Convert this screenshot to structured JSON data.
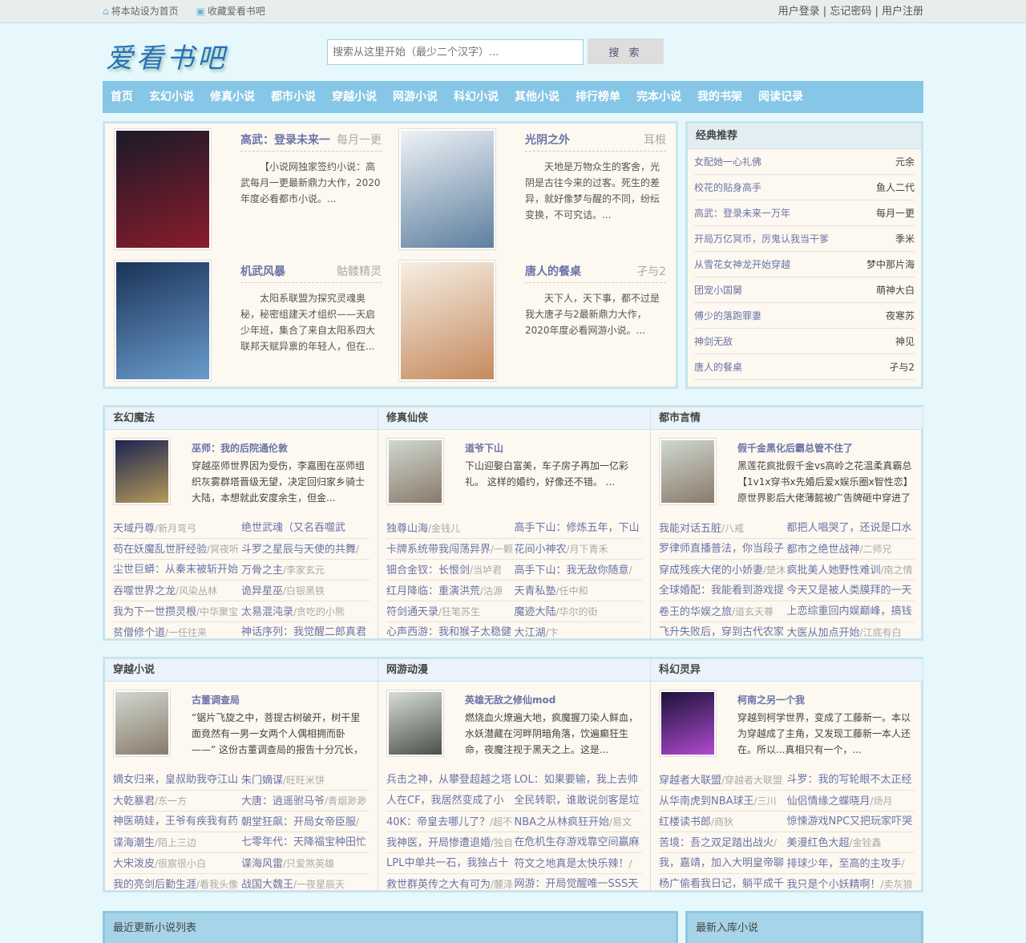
{
  "topbar": {
    "home": "将本站设为首页",
    "fav": "收藏爱看书吧",
    "login": "用户登录",
    "forgot": "忘记密码",
    "register": "用户注册"
  },
  "logo": "爱看书吧",
  "search": {
    "placeholder": "搜索从这里开始（最少二个汉字）...",
    "button": "搜 索"
  },
  "nav": [
    "首页",
    "玄幻小说",
    "修真小说",
    "都市小说",
    "穿越小说",
    "网游小说",
    "科幻小说",
    "其他小说",
    "排行榜单",
    "完本小说",
    "我的书架",
    "阅读记录"
  ],
  "featured": [
    {
      "title": "高武：登录未来一",
      "author": "每月一更",
      "desc": "【小说网独家签约小说：高武每月一更最新鼎力大作，2020年度必看都市小说。...",
      "colors": [
        "#1a1a2a",
        "#8a1c2a"
      ]
    },
    {
      "title": "光阴之外",
      "author": "耳根",
      "desc": "天地是万物众生的客舍，光阴是古往今来的过客。死生的差异，就好像梦与醒的不同，纷纭变换，不可究诘。...",
      "colors": [
        "#eef2f6",
        "#5d7f9e"
      ]
    },
    {
      "title": "机武风暴",
      "author": "骷髅精灵",
      "desc": "太阳系联盟为探究灵魂奥秘，秘密组建天才组织——天启少年班，集合了来自太阳系四大联邦天赋异禀的年轻人，但在...",
      "colors": [
        "#1b3358",
        "#6a9ccc"
      ]
    },
    {
      "title": "唐人的餐桌",
      "author": "孑与2",
      "desc": "天下人，天下事，都不过是我大唐孑与2最新鼎力大作，2020年度必看网游小说。...",
      "colors": [
        "#f6efe4",
        "#c58a5e"
      ]
    }
  ],
  "recommend": {
    "title": "经典推荐",
    "items": [
      [
        "女配她一心礼佛",
        "元余"
      ],
      [
        "校花的贴身高手",
        "鱼人二代"
      ],
      [
        "高武：登录未来一万年",
        "每月一更"
      ],
      [
        "开局万亿冥币，厉鬼认我当干爹",
        "季米"
      ],
      [
        "从雪花女神龙开始穿越",
        "梦中那片海"
      ],
      [
        "团宠小国舅",
        "萌神大白"
      ],
      [
        "傅少的落跑罪妻",
        "夜寒苏"
      ],
      [
        "神剑无敌",
        "神见"
      ],
      [
        "唐人的餐桌",
        "孑与2"
      ]
    ]
  },
  "sections": [
    {
      "name": "玄幻魔法",
      "title": "巫师：我的后院通伦敦",
      "desc": "穿越巫师世界因为受伤，李嘉图在巫师组织灰雾群塔晋级无望，决定回归家乡骑士大陆，本想就此安度余生，但金...",
      "colors": [
        "#1c2450",
        "#b59a5a"
      ],
      "list": [
        [
          "天域丹尊",
          "新月弯弓"
        ],
        [
          "绝世武魂（又名吞噬武",
          null
        ],
        [
          "苟在妖魔乱世肝经验",
          "冥夜听"
        ],
        [
          "斗罗之星辰与天使的共舞",
          ""
        ],
        [
          "尘世巨蟒：从秦末被斩开始",
          null
        ],
        [
          "万骨之主",
          "李家玄元"
        ],
        [
          "吞噬世界之龙",
          "风染丛林"
        ],
        [
          "诡异星巫",
          "白银黑铁"
        ],
        [
          "我为下一世攒灵根",
          "中华聚宝"
        ],
        [
          "太易混沌录",
          "贪吃的小熊"
        ],
        [
          "贫僧修个道",
          "一任往来"
        ],
        [
          "神话序列：我觉醒二郎真君",
          null
        ]
      ]
    },
    {
      "name": "修真仙侠",
      "title": "道爷下山",
      "desc": "下山迎娶白富美，车子房子再加一亿彩礼。 这样的婚约，好像还不错。 ...",
      "colors": [
        "#cfd8d0",
        "#8a7a6a"
      ],
      "list": [
        [
          "独尊山海",
          "金钱儿"
        ],
        [
          "高手下山：修炼五年，下山",
          null
        ],
        [
          "卡牌系统带我闯荡异界",
          "一颗"
        ],
        [
          "花间小神农",
          "月下青禾"
        ],
        [
          "钿合金钗：长恨剑",
          "当垆君"
        ],
        [
          "高手下山：我无敌你随意",
          ""
        ],
        [
          "红月降临：重演洪荒",
          "沽源"
        ],
        [
          "天青私塾",
          "任中和"
        ],
        [
          "符剑通天录",
          "狂笔苏生"
        ],
        [
          "魔迹大陆",
          "华尔的街"
        ],
        [
          "心声西游：我和猴子太稳健",
          null
        ],
        [
          "大江湖",
          "卞"
        ]
      ]
    },
    {
      "name": "都市言情",
      "title": "假千金黑化后霸总管不住了",
      "desc": "黑莲花疯批假千金vs高岭之花温柔真霸总【1v1x穿书x先婚后爱x娱乐圈x智性恋】原世界影后大佬薄懿被广告牌砸中穿进了",
      "colors": [
        "#cfd8d0",
        "#8a7a6a"
      ],
      "list": [
        [
          "我能对话五脏",
          "八戒"
        ],
        [
          "都把人唱哭了，还说是口水",
          null
        ],
        [
          "罗律师直播普法，你当段子",
          null
        ],
        [
          "都市之绝世战神",
          "二师兄"
        ],
        [
          "穿成残疾大佬的小娇妻",
          "楚沐"
        ],
        [
          "疯批美人她野性难训",
          "南之情"
        ],
        [
          "全球婚配：我能看到游戏提",
          null
        ],
        [
          "今天又是被人类膜拜的一天",
          null
        ],
        [
          "卷王的华娱之旅",
          "道玄天尊"
        ],
        [
          "上恋综重回内娱巅峰，搞钱",
          null
        ],
        [
          "飞升失败后，穿到古代农家",
          null
        ],
        [
          "大医从加点开始",
          "江底有白"
        ]
      ]
    },
    {
      "name": "穿越小说",
      "title": "古董调查局",
      "desc": "“锯片飞旋之中，菩提古树破开，树干里面竟然有一男一女两个人偶相拥而卧——” 这份古董调查局的报告十分冗长，其中",
      "colors": [
        "#cfd8d0",
        "#8a7a6a"
      ],
      "list": [
        [
          "嫡女归来，皇叔助我夺江山",
          null
        ],
        [
          "朱门嫡谋",
          "旺旺米饼"
        ],
        [
          "大乾暴君",
          "东一方"
        ],
        [
          "大唐：逍遥驸马爷",
          "青烟渺渺"
        ],
        [
          "神医萌娃，王爷有疾我有药",
          null
        ],
        [
          "朝堂狂飙：开局女帝臣服",
          ""
        ],
        [
          "谍海潮生",
          "陌上三边"
        ],
        [
          "七零年代：天降福宝种田忙",
          null
        ],
        [
          "大宋泼皮",
          "很宸很小白"
        ],
        [
          "谍海风雷",
          "只爱煞英雄"
        ],
        [
          "我的亮剑后勤生涯",
          "看我头像"
        ],
        [
          "战国大魏王",
          "一夜星辰天"
        ]
      ]
    },
    {
      "name": "网游动漫",
      "title": "英雄无敌之修仙mod",
      "desc": "燃烧血火燎遍大地，疯魔握刀染人鲜血，水妖潜藏在河畔阴暗角落，饮遍癫狂生命，夜魔注视于黑天之上。这是...",
      "colors": [
        "#d8dcd8",
        "#4a5048"
      ],
      "list": [
        [
          "兵击之神，从攀登超越之塔",
          null
        ],
        [
          "LOL：如果要输，我上去帅",
          null
        ],
        [
          "人在CF，我居然变成了小",
          null
        ],
        [
          "全民转职，谁敢说剑客是垃",
          null
        ],
        [
          "40K：帝皇去哪儿了？",
          "超不"
        ],
        [
          "NBA之从林疯狂开始",
          "易文"
        ],
        [
          "我神医，开局惨遭退婚",
          "独自"
        ],
        [
          "在危机生存游戏靠空间赢麻",
          null
        ],
        [
          "LPL中单共一石，我独占十",
          null
        ],
        [
          "符文之地真是太快乐辣！",
          ""
        ],
        [
          "救世群英传之大有可为",
          "麓泽"
        ],
        [
          "网游：开局觉醒唯一SSS天",
          null
        ]
      ]
    },
    {
      "name": "科幻灵异",
      "title": "柯南之另一个我",
      "desc": "穿越到柯学世界，变成了工藤新一。本以为穿越成了主角，又发现工藤新一本人还在。所以...真相只有一个，...",
      "colors": [
        "#1a1238",
        "#b04ad0"
      ],
      "list": [
        [
          "穿越者大联盟",
          "穿越者大联盟"
        ],
        [
          "斗罗：我的写轮眼不太正经",
          null
        ],
        [
          "从华南虎到NBA球王",
          "三川"
        ],
        [
          "仙侣情缘之蝶晓月",
          "炀月"
        ],
        [
          "红楼读书郎",
          "商狄"
        ],
        [
          "惊悚游戏NPC又把玩家吓哭",
          null
        ],
        [
          "苦境：吾之双足踏出战火",
          ""
        ],
        [
          "美漫红色大超",
          "金铨鑫"
        ],
        [
          "我，嘉靖，加入大明皇帝聊",
          null
        ],
        [
          "排球少年，至高的主攻手",
          ""
        ],
        [
          "杨广偷看我日记，躺平成千",
          null
        ],
        [
          "我只是个小妖精啊！",
          "卖灰狼"
        ]
      ]
    }
  ],
  "bottom": {
    "left": "最近更新小说列表",
    "right": "最新入库小说"
  },
  "colors": {
    "nav": "#86c6e6",
    "link": "#6a73a8",
    "background": "#e6f8fc",
    "panel": "#fdf8f0"
  }
}
